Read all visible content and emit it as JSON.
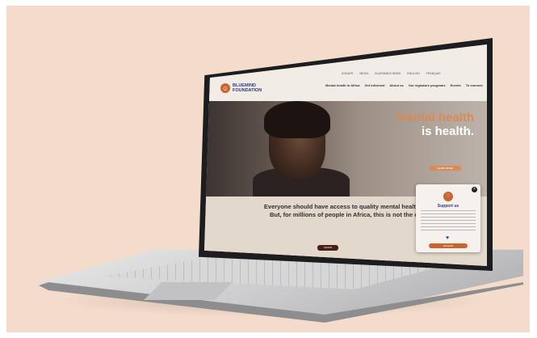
{
  "website": {
    "logo": {
      "name": "BLUEMIND",
      "sub": "FOUNDATION"
    },
    "top_links": [
      "DONATE",
      "MEDIA",
      "BLUEMINDS NEWS",
      "ENGLISH",
      "FRANÇAIS"
    ],
    "main_nav": [
      "Mental health in Africa",
      "Get informed",
      "About us",
      "Our signature programs",
      "Events",
      "To connect"
    ],
    "hero": {
      "title_line1": "Mental health",
      "title_line2": "is health.",
      "button": "LEARN MORE"
    },
    "tagline_line1": "Everyone should have access to quality mental health care.",
    "tagline_line2": "But, for millions of people in Africa, this is not the case.",
    "learn_button": "LEARN",
    "support_popup": {
      "title": "Support us",
      "close": "×",
      "button": "DONATE"
    }
  },
  "colors": {
    "background": "#f3dccb",
    "accent": "#d98a56",
    "brand_blue": "#2f3a7a"
  }
}
